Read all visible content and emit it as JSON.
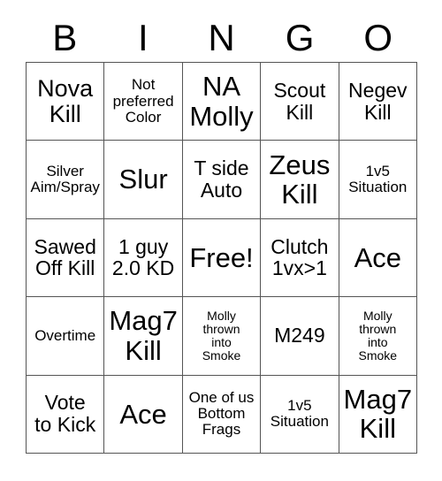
{
  "header": {
    "letters": [
      "B",
      "I",
      "N",
      "G",
      "O"
    ]
  },
  "grid": {
    "rows": 5,
    "columns": 5,
    "border_color": "#555555",
    "background_color": "#ffffff",
    "text_color": "#000000",
    "cells": [
      {
        "text": "Nova\nKill",
        "size": "lg"
      },
      {
        "text": "Not\npreferred\nColor",
        "size": "sm"
      },
      {
        "text": "NA\nMolly",
        "size": "xl"
      },
      {
        "text": "Scout\nKill",
        "size": "md"
      },
      {
        "text": "Negev\nKill",
        "size": "md"
      },
      {
        "text": "Silver\nAim/Spray",
        "size": "sm"
      },
      {
        "text": "Slur",
        "size": "xl"
      },
      {
        "text": "T side\nAuto",
        "size": "md"
      },
      {
        "text": "Zeus\nKill",
        "size": "xl"
      },
      {
        "text": "1v5\nSituation",
        "size": "sm"
      },
      {
        "text": "Sawed\nOff Kill",
        "size": "md"
      },
      {
        "text": "1 guy\n2.0 KD",
        "size": "md"
      },
      {
        "text": "Free!",
        "size": "xl"
      },
      {
        "text": "Clutch\n1vx>1",
        "size": "md"
      },
      {
        "text": "Ace",
        "size": "xl"
      },
      {
        "text": "Overtime",
        "size": "sm"
      },
      {
        "text": "Mag7\nKill",
        "size": "xl"
      },
      {
        "text": "Molly\nthrown\ninto\nSmoke",
        "size": "xs"
      },
      {
        "text": "M249",
        "size": "md"
      },
      {
        "text": "Molly\nthrown\ninto\nSmoke",
        "size": "xs"
      },
      {
        "text": "Vote\nto Kick",
        "size": "md"
      },
      {
        "text": "Ace",
        "size": "xl"
      },
      {
        "text": "One of us\nBottom\nFrags",
        "size": "sm"
      },
      {
        "text": "1v5\nSituation",
        "size": "sm"
      },
      {
        "text": "Mag7\nKill",
        "size": "xl"
      }
    ]
  }
}
